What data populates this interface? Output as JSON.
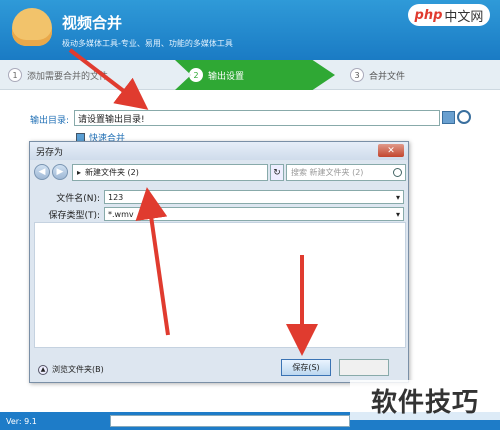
{
  "app": {
    "title": "视频合并",
    "subtitle": "极动多媒体工具-专业、易用、功能的多媒体工具",
    "brand_php": "php",
    "brand_rest": "中文网"
  },
  "steps": [
    {
      "num": "1",
      "label": "添加需要合并的文件"
    },
    {
      "num": "2",
      "label": "输出设置"
    },
    {
      "num": "3",
      "label": "合并文件"
    }
  ],
  "output": {
    "label": "输出目录:",
    "value": "请设置输出目录!",
    "quick_merge_label": "快速合并"
  },
  "dialog": {
    "title": "另存为",
    "close": "✕",
    "path": "新建文件夹 (2)",
    "search_placeholder": "搜索 新建文件夹 (2)",
    "filename_label": "文件名(N):",
    "filename_value": "123",
    "filetype_label": "保存类型(T):",
    "filetype_value": "*.wmv",
    "browse_label": "浏览文件夹(B)",
    "save_label": "保存(S)"
  },
  "status": {
    "version": "Ver: 9.1"
  },
  "watermark": "软件技巧",
  "colors": {
    "accent": "#1e7cc8",
    "step_active": "#2fa834",
    "arrow": "#e03b2f"
  }
}
